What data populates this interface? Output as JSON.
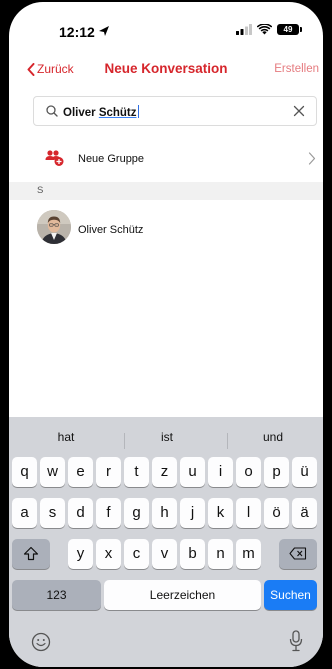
{
  "status_bar": {
    "time": "12:12",
    "battery": "49"
  },
  "nav": {
    "back_label": "Zurück",
    "title": "Neue Konversation",
    "create_label": "Erstellen"
  },
  "search": {
    "value_prefix": "Oliver ",
    "value_underlined": "Schütz"
  },
  "group": {
    "label": "Neue Gruppe"
  },
  "section": {
    "letter": "S"
  },
  "contacts": [
    {
      "name": "Oliver Schütz"
    }
  ],
  "keyboard": {
    "suggestions": [
      "hat",
      "ist",
      "und"
    ],
    "row1": [
      "q",
      "w",
      "e",
      "r",
      "t",
      "z",
      "u",
      "i",
      "o",
      "p",
      "ü"
    ],
    "row2": [
      "a",
      "s",
      "d",
      "f",
      "g",
      "h",
      "j",
      "k",
      "l",
      "ö",
      "ä"
    ],
    "row3": [
      "y",
      "x",
      "c",
      "v",
      "b",
      "n",
      "m"
    ],
    "numbers_label": "123",
    "space_label": "Leerzeichen",
    "search_label": "Suchen"
  },
  "colors": {
    "accent": "#d6262c",
    "create_disabled": "#e57b7f",
    "key_blue": "#1a7cf5",
    "keyboard_bg": "#d2d4d9"
  },
  "icons": [
    "location-arrow-icon",
    "signal-icon",
    "wifi-icon",
    "battery-icon",
    "chevron-left-icon",
    "search-icon",
    "clear-icon",
    "new-group-icon",
    "chevron-right-icon",
    "shift-icon",
    "backspace-icon",
    "emoji-icon",
    "microphone-icon"
  ]
}
